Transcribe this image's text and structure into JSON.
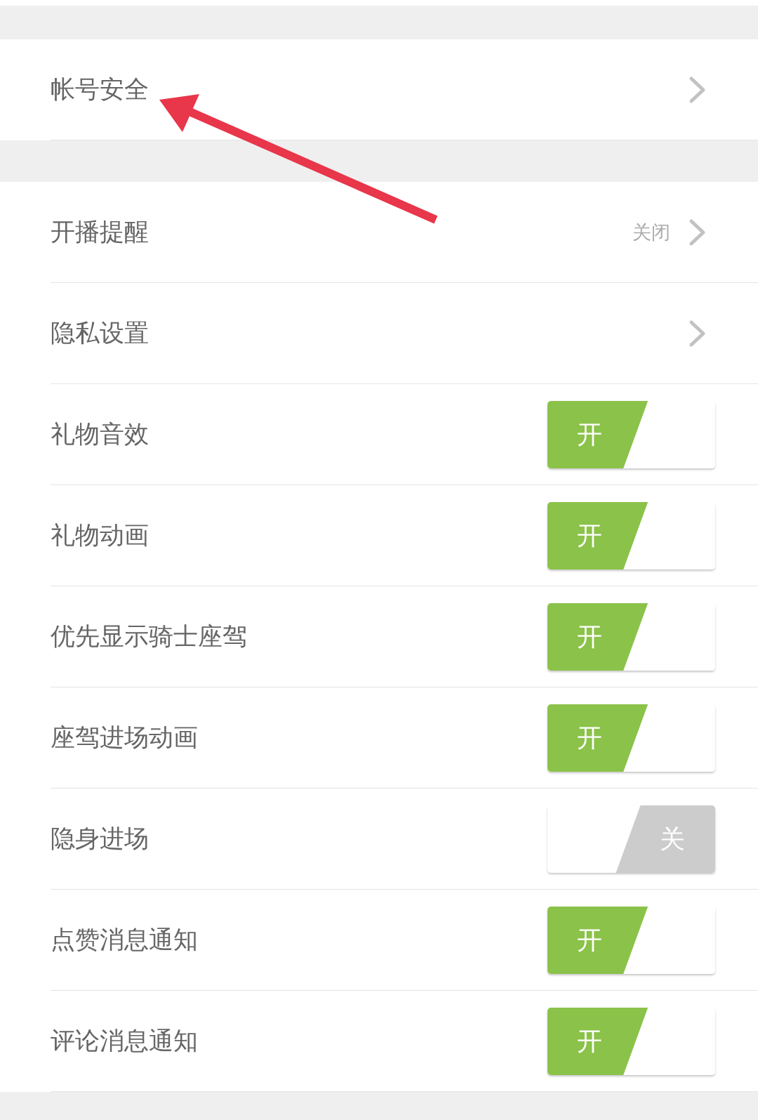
{
  "sections": [
    {
      "items": [
        {
          "kind": "link",
          "label": "帐号安全"
        }
      ]
    },
    {
      "items": [
        {
          "kind": "link",
          "label": "开播提醒",
          "value": "关闭"
        },
        {
          "kind": "link",
          "label": "隐私设置"
        },
        {
          "kind": "toggle",
          "label": "礼物音效",
          "on": true,
          "text": "开"
        },
        {
          "kind": "toggle",
          "label": "礼物动画",
          "on": true,
          "text": "开"
        },
        {
          "kind": "toggle",
          "label": "优先显示骑士座驾",
          "on": true,
          "text": "开"
        },
        {
          "kind": "toggle",
          "label": "座驾进场动画",
          "on": true,
          "text": "开"
        },
        {
          "kind": "toggle",
          "label": "隐身进场",
          "on": false,
          "text": "关"
        },
        {
          "kind": "toggle",
          "label": "点赞消息通知",
          "on": true,
          "text": "开"
        },
        {
          "kind": "toggle",
          "label": "评论消息通知",
          "on": true,
          "text": "开"
        }
      ]
    }
  ],
  "annotations": [
    {
      "kind": "arrow"
    }
  ]
}
